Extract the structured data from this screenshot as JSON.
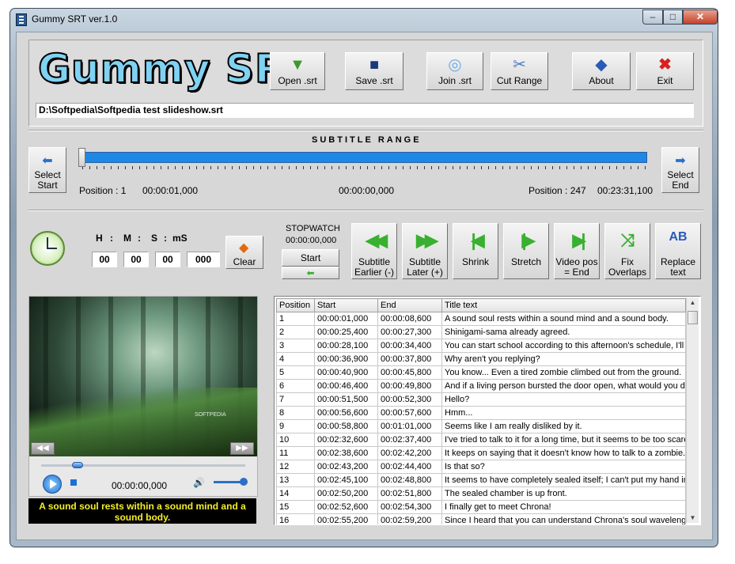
{
  "window": {
    "title": "Gummy SRT ver.1.0"
  },
  "logo": "Gummy SRT",
  "toolbar": [
    {
      "label": "Open .srt",
      "icon": "open-folder-icon",
      "color": "#3a9a2a"
    },
    {
      "label": "Save .srt",
      "icon": "floppy-disk-icon",
      "color": "#1a3a7a"
    },
    {
      "label": "Join .srt",
      "icon": "join-circles-icon",
      "color": "#6aa8e8"
    },
    {
      "label": "Cut Range",
      "icon": "scissors-icon",
      "color": "#4a7ac8"
    },
    {
      "label": "About",
      "icon": "info-diamond-icon",
      "color": "#2a5ab8"
    },
    {
      "label": "Exit",
      "icon": "red-x-icon",
      "color": "#d82020"
    }
  ],
  "file_path": "D:\\Softpedia\\Softpedia test slideshow.srt",
  "range": {
    "title": "SUBTITLE   RANGE",
    "select_start": "Select Start",
    "select_end": "Select End",
    "start_position": "Position : 1",
    "start_time": "00:00:01,000",
    "mid_time": "00:00:00,000",
    "end_position": "Position : 247",
    "end_time": "00:23:31,100"
  },
  "timer": {
    "labels": {
      "h": "H",
      "m": "M",
      "s": "S",
      "ms": "mS"
    },
    "hours": "00",
    "minutes": "00",
    "seconds": "00",
    "millis": "000",
    "clear": "Clear"
  },
  "stopwatch": {
    "label": "STOPWATCH",
    "time": "00:00:00,000",
    "start": "Start"
  },
  "functions": [
    {
      "line1": "Subtitle",
      "line2": "Earlier (-)",
      "icon": "double-left-arrow-icon"
    },
    {
      "line1": "Subtitle",
      "line2": "Later (+)",
      "icon": "double-right-arrow-icon"
    },
    {
      "line1": "Shrink",
      "line2": "",
      "icon": "shrink-arrow-icon"
    },
    {
      "line1": "Stretch",
      "line2": "",
      "icon": "stretch-arrow-icon"
    },
    {
      "line1": "Video pos",
      "line2": "=  End",
      "icon": "arrow-to-end-icon"
    },
    {
      "line1": "Fix",
      "line2": "Overlaps",
      "icon": "shuffle-arrows-icon"
    },
    {
      "line1": "Replace",
      "line2": "text",
      "icon": "replace-ab-icon"
    }
  ],
  "player": {
    "time": "00:00:00,000",
    "watermark": "SOFTPEDIA",
    "caption": "A sound soul rests within a sound mind and a sound body.",
    "seek_fraction": 0.18
  },
  "table": {
    "columns": [
      "Position",
      "Start",
      "End",
      "Title text"
    ],
    "rows": [
      [
        "1",
        "00:00:01,000",
        "00:00:08,600",
        "A sound soul rests within a sound mind and a sound body."
      ],
      [
        "2",
        "00:00:25,400",
        "00:00:27,300",
        "Shinigami-sama already agreed."
      ],
      [
        "3",
        "00:00:28,100",
        "00:00:34,400",
        "You can start school according to this afternoon's schedule, I'll"
      ],
      [
        "4",
        "00:00:36,900",
        "00:00:37,800",
        "Why aren't you replying?"
      ],
      [
        "5",
        "00:00:40,900",
        "00:00:45,800",
        "You know... Even a tired zombie climbed out from the ground."
      ],
      [
        "6",
        "00:00:46,400",
        "00:00:49,800",
        "And if a living person bursted the door open, what would you d"
      ],
      [
        "7",
        "00:00:51,500",
        "00:00:52,300",
        "Hello?"
      ],
      [
        "8",
        "00:00:56,600",
        "00:00:57,600",
        "Hmm..."
      ],
      [
        "9",
        "00:00:58,800",
        "00:01:01,000",
        "Seems like I am really disliked by it."
      ],
      [
        "10",
        "00:02:32,600",
        "00:02:37,400",
        "I've tried to talk to it for a long time, but it seems to be too scared"
      ],
      [
        "11",
        "00:02:38,600",
        "00:02:42,200",
        "It keeps on saying that it doesn't know how to talk to a zombie."
      ],
      [
        "12",
        "00:02:43,200",
        "00:02:44,400",
        "Is that so?"
      ],
      [
        "13",
        "00:02:45,100",
        "00:02:48,800",
        "It seems to have completely sealed itself; I can't put my hand in."
      ],
      [
        "14",
        "00:02:50,200",
        "00:02:51,800",
        "The sealed chamber is up front."
      ],
      [
        "15",
        "00:02:52,600",
        "00:02:54,300",
        "I finally get to meet Chrona!"
      ],
      [
        "16",
        "00:02:55,200",
        "00:02:59,200",
        "Since I heard that you can understand Chrona's soul wavelengt"
      ]
    ]
  }
}
